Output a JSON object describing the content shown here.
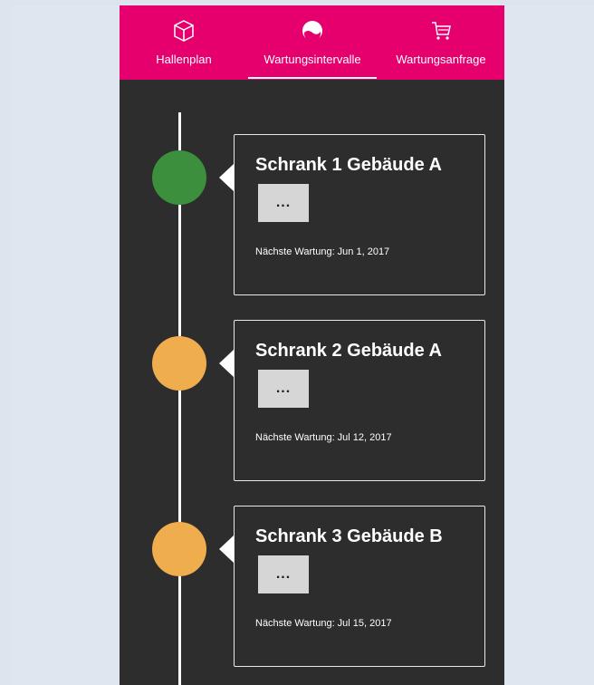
{
  "nav": {
    "items": [
      {
        "label": "Hallenplan",
        "icon": "cube-icon"
      },
      {
        "label": "Wartungsintervalle",
        "icon": "gauge-icon"
      },
      {
        "label": "Wartungsanfrage",
        "icon": "cart-icon"
      }
    ],
    "active_index": 1,
    "background": "#e5006d"
  },
  "timeline": {
    "items": [
      {
        "title": "Schrank 1 Gebäude A",
        "more_label": "...",
        "next_service": "Nächste Wartung: Jun 1, 2017",
        "status_color": "#3c8f3c"
      },
      {
        "title": "Schrank 2 Gebäude A",
        "more_label": "...",
        "next_service": "Nächste Wartung: Jul 12, 2017",
        "status_color": "#f0ad4e"
      },
      {
        "title": "Schrank 3 Gebäude B",
        "more_label": "...",
        "next_service": "Nächste Wartung: Jul 15, 2017",
        "status_color": "#f0ad4e"
      }
    ]
  }
}
